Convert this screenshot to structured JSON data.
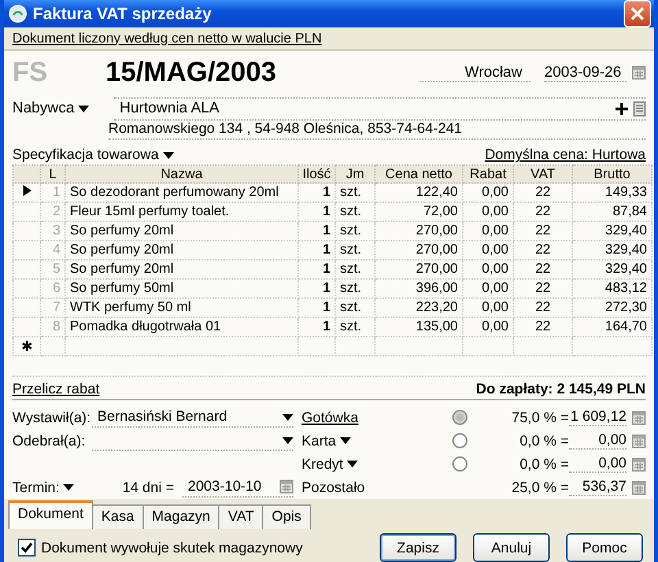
{
  "window": {
    "title": "Faktura VAT sprzedaży"
  },
  "info_bar": "Dokument liczony według cen netto w walucie PLN",
  "document": {
    "type": "FS",
    "number": "15/MAG/2003",
    "place": "Wrocław",
    "date": "2003-09-26"
  },
  "buyer": {
    "label": "Nabywca",
    "name": "Hurtownia ALA",
    "address": "Romanowskiego 134 , 54-948 Oleśnica, 853-74-64-241"
  },
  "specification": {
    "label": "Specyfikacja towarowa",
    "default_price": "Domyślna cena: Hurtowa"
  },
  "table": {
    "columns": [
      "L",
      "Nazwa",
      "Ilość",
      "Jm",
      "Cena netto",
      "Rabat",
      "VAT",
      "Brutto"
    ],
    "rows": [
      {
        "selected": true,
        "cells": [
          "1",
          "So dezodorant perfumowany 20ml",
          "1",
          "szt.",
          "122,40",
          "0,00",
          "22",
          "149,33"
        ]
      },
      {
        "selected": false,
        "cells": [
          "2",
          "Fleur 15ml perfumy toalet.",
          "1",
          "szt.",
          "72,00",
          "0,00",
          "22",
          "87,84"
        ]
      },
      {
        "selected": false,
        "cells": [
          "3",
          "So perfumy 20ml",
          "1",
          "szt.",
          "270,00",
          "0,00",
          "22",
          "329,40"
        ]
      },
      {
        "selected": false,
        "cells": [
          "4",
          "So perfumy 20ml",
          "1",
          "szt.",
          "270,00",
          "0,00",
          "22",
          "329,40"
        ]
      },
      {
        "selected": false,
        "cells": [
          "5",
          "So perfumy 20ml",
          "1",
          "szt.",
          "270,00",
          "0,00",
          "22",
          "329,40"
        ]
      },
      {
        "selected": false,
        "cells": [
          "6",
          "So perfumy 50ml",
          "1",
          "szt.",
          "396,00",
          "0,00",
          "22",
          "483,12"
        ]
      },
      {
        "selected": false,
        "cells": [
          "7",
          "WTK perfumy 50 ml",
          "1",
          "szt.",
          "223,20",
          "0,00",
          "22",
          "272,30"
        ]
      },
      {
        "selected": false,
        "cells": [
          "8",
          "Pomadka długotrwała 01",
          "1",
          "szt.",
          "135,00",
          "0,00",
          "22",
          "164,70"
        ]
      }
    ],
    "new_row_marker": "✱"
  },
  "discount_link": "Przelicz rabat",
  "total": "Do zapłaty: 2 145,49 PLN",
  "issued_by": {
    "label": "Wystawił(a):",
    "value": "Bernasiński Bernard"
  },
  "received_by": {
    "label": "Odebrał(a):"
  },
  "term": {
    "label": "Termin:",
    "days": "14 dni =",
    "date": "2003-10-10"
  },
  "payments": [
    {
      "kind": "link",
      "label": "Gotówka",
      "selected": true,
      "percent": "75,0 % =",
      "amount": "1 609,12"
    },
    {
      "kind": "dropdown",
      "label": "Karta",
      "selected": false,
      "percent": "0,0 % =",
      "amount": "0,00"
    },
    {
      "kind": "dropdown",
      "label": "Kredyt",
      "selected": false,
      "percent": "0,0 % =",
      "amount": "0,00"
    },
    {
      "kind": "remainder",
      "label": "Pozostało",
      "percent": "25,0 % =",
      "amount": "536,37"
    }
  ],
  "tabs": [
    {
      "label": "Dokument",
      "selected": true
    },
    {
      "label": "Kasa",
      "selected": false
    },
    {
      "label": "Magazyn",
      "selected": false
    },
    {
      "label": "VAT",
      "selected": false
    },
    {
      "label": "Opis",
      "selected": false
    }
  ],
  "warehouse_checkbox": {
    "label": "Dokument wywołuje skutek magazynowy",
    "checked": true
  },
  "buttons": [
    "Zapisz",
    "Anuluj",
    "Pomoc"
  ]
}
